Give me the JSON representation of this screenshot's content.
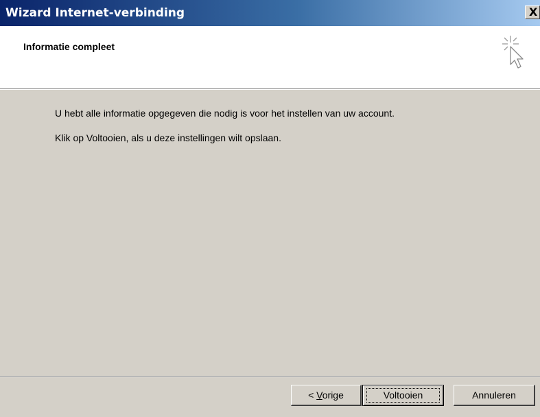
{
  "window": {
    "title": "Wizard Internet-verbinding",
    "close_label": "X"
  },
  "header": {
    "title": "Informatie compleet",
    "icon": "wizard-cursor-icon"
  },
  "body": {
    "line1": "U hebt alle informatie opgegeven die nodig is voor het instellen van uw account.",
    "line2": "Klik op Voltooien, als u deze instellingen wilt opslaan."
  },
  "buttons": {
    "back_prefix": "< ",
    "back_mnemonic": "V",
    "back_rest": "orige",
    "finish": "Voltooien",
    "cancel": "Annuleren"
  },
  "colors": {
    "titlebar_start": "#0a246a",
    "titlebar_end": "#a6caf0",
    "face": "#d4d0c8"
  }
}
